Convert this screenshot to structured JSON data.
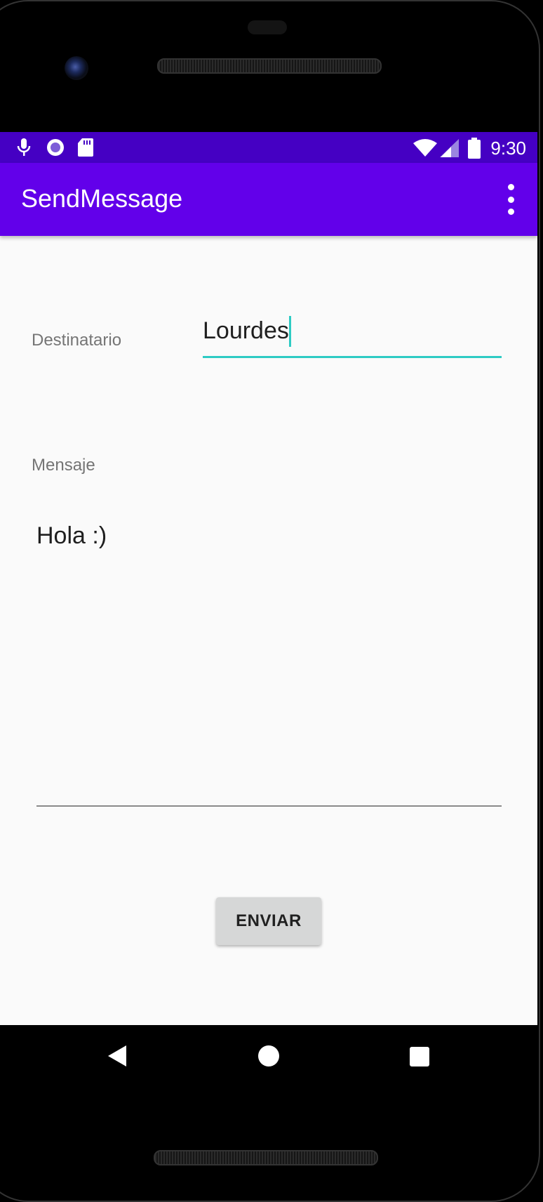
{
  "status_bar": {
    "time": "9:30",
    "left_icons": [
      "mic-icon",
      "media-icon",
      "sd-card-icon"
    ],
    "right_icons": [
      "wifi-icon",
      "cell-signal-icon",
      "battery-icon"
    ],
    "color": "#4500c3"
  },
  "app_bar": {
    "title": "SendMessage",
    "menu_icon": "more-vert-icon",
    "color": "#6200ea"
  },
  "form": {
    "recipient_label": "Destinatario",
    "recipient_value": "Lourdes",
    "message_label": "Mensaje",
    "message_value": "Hola :)",
    "accent_color": "#2ecbc4"
  },
  "send_button": {
    "label": "ENVIAR"
  },
  "nav_bar": {
    "buttons": [
      "back-icon",
      "home-icon",
      "recents-icon"
    ]
  }
}
